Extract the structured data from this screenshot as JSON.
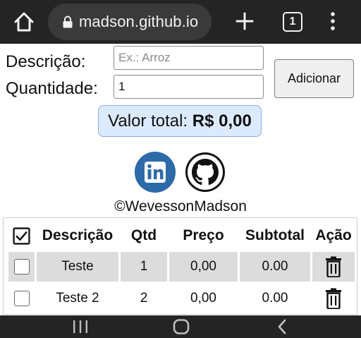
{
  "browser": {
    "url": "madson.github.io",
    "tab_count": "1",
    "icons": [
      "home-icon",
      "lock-icon",
      "new-tab-plus-icon",
      "tab-switcher-icon",
      "overflow-menu-icon"
    ]
  },
  "form": {
    "description_label": "Descrição:",
    "description_placeholder": "Ex.: Arroz",
    "description_value": "",
    "quantity_label": "Quantidade:",
    "quantity_value": "1",
    "add_button_label": "Adicionar"
  },
  "total": {
    "label": "Valor total:",
    "value": "R$ 0,00"
  },
  "social": {
    "credit": "©WevessonMadson",
    "icons": [
      "linkedin-icon",
      "github-icon"
    ]
  },
  "table": {
    "headers": [
      "Descrição",
      "Qtd",
      "Preço",
      "Subtotal",
      "Ação"
    ],
    "rows": [
      {
        "description": "Teste",
        "qty": "1",
        "price": "0,00",
        "subtotal": "0.00",
        "checked": false
      },
      {
        "description": "Teste 2",
        "qty": "2",
        "price": "0,00",
        "subtotal": "0.00",
        "checked": false
      }
    ]
  },
  "colors": {
    "browser_bar": "#242424",
    "total_background": "#dbeaff",
    "linkedin_blue": "#2d6ba8",
    "row_gray": "#dcdcdc"
  }
}
